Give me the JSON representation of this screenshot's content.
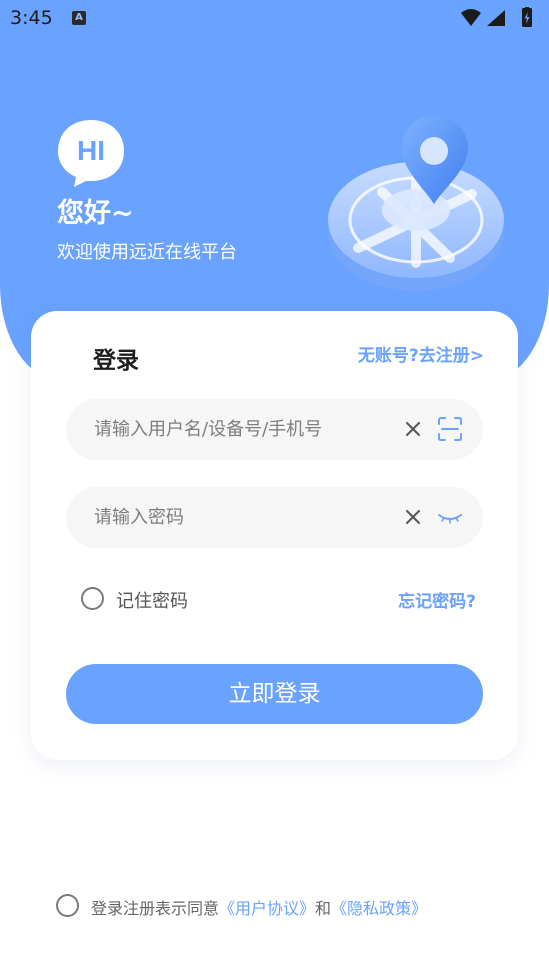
{
  "colors": {
    "accent": "#6aa2ff",
    "card_bg": "#ffffff",
    "input_bg": "#f6f6f6"
  },
  "status_bar": {
    "time": "3:45",
    "notification_icon": "A",
    "icons": [
      "wifi-icon",
      "signal-icon",
      "battery-charging-icon"
    ]
  },
  "header": {
    "logo_text": "HI",
    "greeting": "您好~",
    "welcome": "欢迎使用远近在线平台",
    "illustration": "map-pin-illustration"
  },
  "login_card": {
    "title": "登录",
    "register_link": "无账号?去注册>",
    "username_placeholder": "请输入用户名/设备号/手机号",
    "password_placeholder": "请输入密码",
    "remember_label": "记住密码",
    "forgot_link": "忘记密码?",
    "login_button": "立即登录"
  },
  "agreement": {
    "prefix": "登录注册表示同意",
    "user_agreement": "《用户协议》",
    "and": "和",
    "privacy_policy": "《隐私政策》"
  }
}
